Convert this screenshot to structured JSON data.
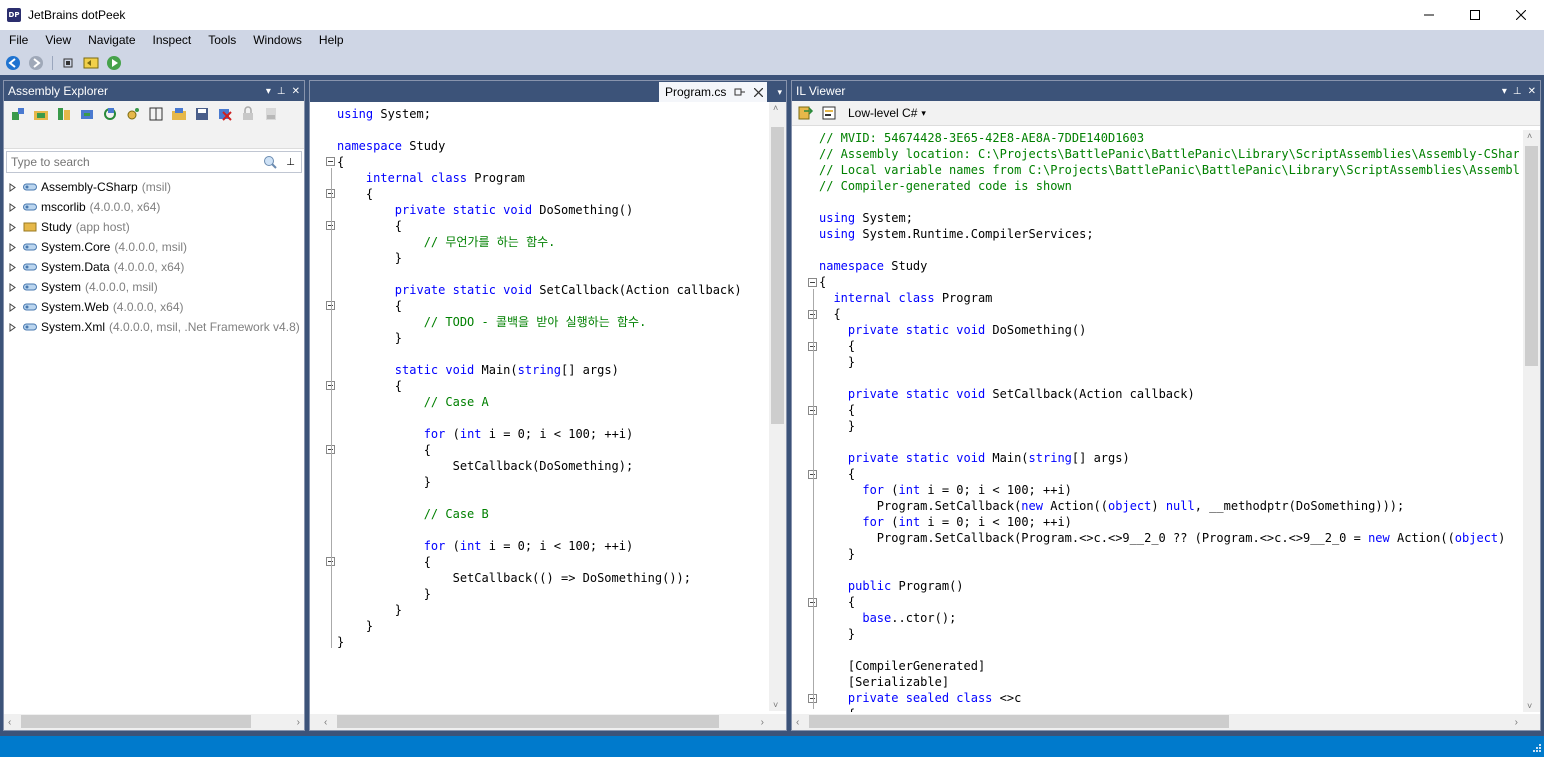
{
  "window": {
    "title": "JetBrains dotPeek",
    "logo_text": "DP"
  },
  "menu": [
    "File",
    "View",
    "Navigate",
    "Inspect",
    "Tools",
    "Windows",
    "Help"
  ],
  "assembly_explorer": {
    "title": "Assembly Explorer",
    "search_placeholder": "Type to search",
    "items": [
      {
        "name": "Assembly-CSharp",
        "meta": "(msil)"
      },
      {
        "name": "mscorlib",
        "meta": "(4.0.0.0, x64)"
      },
      {
        "name": "Study",
        "meta": "(app host)"
      },
      {
        "name": "System.Core",
        "meta": "(4.0.0.0, msil)"
      },
      {
        "name": "System.Data",
        "meta": "(4.0.0.0, x64)"
      },
      {
        "name": "System",
        "meta": "(4.0.0.0, msil)"
      },
      {
        "name": "System.Web",
        "meta": "(4.0.0.0, x64)"
      },
      {
        "name": "System.Xml",
        "meta": "(4.0.0.0, msil, .Net Framework v4.8)"
      }
    ]
  },
  "editor": {
    "tab_label": "Program.cs",
    "lines": [
      [
        {
          "t": "using",
          "c": "kw"
        },
        {
          "t": " System;"
        }
      ],
      [
        {
          "t": ""
        }
      ],
      [
        {
          "t": "namespace",
          "c": "kw"
        },
        {
          "t": " Study"
        }
      ],
      [
        {
          "t": "{"
        }
      ],
      [
        {
          "t": "    "
        },
        {
          "t": "internal class",
          "c": "kw"
        },
        {
          "t": " Program"
        }
      ],
      [
        {
          "t": "    {"
        }
      ],
      [
        {
          "t": "        "
        },
        {
          "t": "private static void",
          "c": "kw"
        },
        {
          "t": " DoSomething()"
        }
      ],
      [
        {
          "t": "        {"
        }
      ],
      [
        {
          "t": "            "
        },
        {
          "t": "// 무언가를 하는 함수.",
          "c": "cm"
        }
      ],
      [
        {
          "t": "        }"
        }
      ],
      [
        {
          "t": ""
        }
      ],
      [
        {
          "t": "        "
        },
        {
          "t": "private static void",
          "c": "kw"
        },
        {
          "t": " SetCallback(Action callback)"
        }
      ],
      [
        {
          "t": "        {"
        }
      ],
      [
        {
          "t": "            "
        },
        {
          "t": "// TODO - 콜백을 받아 실행하는 함수.",
          "c": "cm"
        }
      ],
      [
        {
          "t": "        }"
        }
      ],
      [
        {
          "t": ""
        }
      ],
      [
        {
          "t": "        "
        },
        {
          "t": "static void",
          "c": "kw"
        },
        {
          "t": " Main("
        },
        {
          "t": "string",
          "c": "kw"
        },
        {
          "t": "[] args)"
        }
      ],
      [
        {
          "t": "        {"
        }
      ],
      [
        {
          "t": "            "
        },
        {
          "t": "// Case A",
          "c": "cm"
        }
      ],
      [
        {
          "t": ""
        }
      ],
      [
        {
          "t": "            "
        },
        {
          "t": "for",
          "c": "kw"
        },
        {
          "t": " ("
        },
        {
          "t": "int",
          "c": "kw"
        },
        {
          "t": " i = 0; i < 100; ++i)"
        }
      ],
      [
        {
          "t": "            {"
        }
      ],
      [
        {
          "t": "                SetCallback(DoSomething);"
        }
      ],
      [
        {
          "t": "            }"
        }
      ],
      [
        {
          "t": ""
        }
      ],
      [
        {
          "t": "            "
        },
        {
          "t": "// Case B",
          "c": "cm"
        }
      ],
      [
        {
          "t": ""
        }
      ],
      [
        {
          "t": "            "
        },
        {
          "t": "for",
          "c": "kw"
        },
        {
          "t": " ("
        },
        {
          "t": "int",
          "c": "kw"
        },
        {
          "t": " i = 0; i < 100; ++i)"
        }
      ],
      [
        {
          "t": "            {"
        }
      ],
      [
        {
          "t": "                SetCallback(() => DoSomething());"
        }
      ],
      [
        {
          "t": "            }"
        }
      ],
      [
        {
          "t": "        }"
        }
      ],
      [
        {
          "t": "    }"
        }
      ],
      [
        {
          "t": "}"
        }
      ]
    ]
  },
  "il_viewer": {
    "title": "IL Viewer",
    "mode_label": "Low-level C#",
    "lines": [
      [
        {
          "t": "// MVID: 54674428-3E65-42E8-AE8A-7DDE140D1603",
          "c": "cm"
        }
      ],
      [
        {
          "t": "// Assembly location: C:\\Projects\\BattlePanic\\BattlePanic\\Library\\ScriptAssemblies\\Assembly-CSharp",
          "c": "cm"
        }
      ],
      [
        {
          "t": "// Local variable names from C:\\Projects\\BattlePanic\\BattlePanic\\Library\\ScriptAssemblies\\Assembly-",
          "c": "cm"
        }
      ],
      [
        {
          "t": "// Compiler-generated code is shown",
          "c": "cm"
        }
      ],
      [
        {
          "t": ""
        }
      ],
      [
        {
          "t": "using",
          "c": "kw"
        },
        {
          "t": " System;"
        }
      ],
      [
        {
          "t": "using",
          "c": "kw"
        },
        {
          "t": " System.Runtime.CompilerServices;"
        }
      ],
      [
        {
          "t": ""
        }
      ],
      [
        {
          "t": "namespace",
          "c": "kw"
        },
        {
          "t": " Study"
        }
      ],
      [
        {
          "t": "{"
        }
      ],
      [
        {
          "t": "  "
        },
        {
          "t": "internal class",
          "c": "kw"
        },
        {
          "t": " Program"
        }
      ],
      [
        {
          "t": "  {"
        }
      ],
      [
        {
          "t": "    "
        },
        {
          "t": "private static void",
          "c": "kw"
        },
        {
          "t": " DoSomething()"
        }
      ],
      [
        {
          "t": "    {"
        }
      ],
      [
        {
          "t": "    }"
        }
      ],
      [
        {
          "t": ""
        }
      ],
      [
        {
          "t": "    "
        },
        {
          "t": "private static void",
          "c": "kw"
        },
        {
          "t": " SetCallback(Action callback)"
        }
      ],
      [
        {
          "t": "    {"
        }
      ],
      [
        {
          "t": "    }"
        }
      ],
      [
        {
          "t": ""
        }
      ],
      [
        {
          "t": "    "
        },
        {
          "t": "private static void",
          "c": "kw"
        },
        {
          "t": " Main("
        },
        {
          "t": "string",
          "c": "kw"
        },
        {
          "t": "[] args)"
        }
      ],
      [
        {
          "t": "    {"
        }
      ],
      [
        {
          "t": "      "
        },
        {
          "t": "for",
          "c": "kw"
        },
        {
          "t": " ("
        },
        {
          "t": "int",
          "c": "kw"
        },
        {
          "t": " i = 0; i < 100; ++i)"
        }
      ],
      [
        {
          "t": "        Program.SetCallback("
        },
        {
          "t": "new",
          "c": "kw"
        },
        {
          "t": " Action(("
        },
        {
          "t": "object",
          "c": "kw"
        },
        {
          "t": ") "
        },
        {
          "t": "null",
          "c": "kw"
        },
        {
          "t": ", __methodptr(DoSomething)));"
        }
      ],
      [
        {
          "t": "      "
        },
        {
          "t": "for",
          "c": "kw"
        },
        {
          "t": " ("
        },
        {
          "t": "int",
          "c": "kw"
        },
        {
          "t": " i = 0; i < 100; ++i)"
        }
      ],
      [
        {
          "t": "        Program.SetCallback(Program.<>c.<>9__2_0 ?? (Program.<>c.<>9__2_0 = "
        },
        {
          "t": "new",
          "c": "kw"
        },
        {
          "t": " Action(("
        },
        {
          "t": "object",
          "c": "kw"
        },
        {
          "t": ")"
        }
      ],
      [
        {
          "t": "    }"
        }
      ],
      [
        {
          "t": ""
        }
      ],
      [
        {
          "t": "    "
        },
        {
          "t": "public",
          "c": "kw"
        },
        {
          "t": " Program()"
        }
      ],
      [
        {
          "t": "    {"
        }
      ],
      [
        {
          "t": "      "
        },
        {
          "t": "base",
          "c": "kw"
        },
        {
          "t": "..ctor();"
        }
      ],
      [
        {
          "t": "    }"
        }
      ],
      [
        {
          "t": ""
        }
      ],
      [
        {
          "t": "    [CompilerGenerated]"
        }
      ],
      [
        {
          "t": "    [Serializable]"
        }
      ],
      [
        {
          "t": "    "
        },
        {
          "t": "private sealed class",
          "c": "kw"
        },
        {
          "t": " <>c"
        }
      ],
      [
        {
          "t": "    {"
        }
      ]
    ]
  },
  "colors": {
    "accent": "#3c5379",
    "status_bar": "#007acc",
    "keyword": "#0000ff",
    "comment": "#008000"
  }
}
